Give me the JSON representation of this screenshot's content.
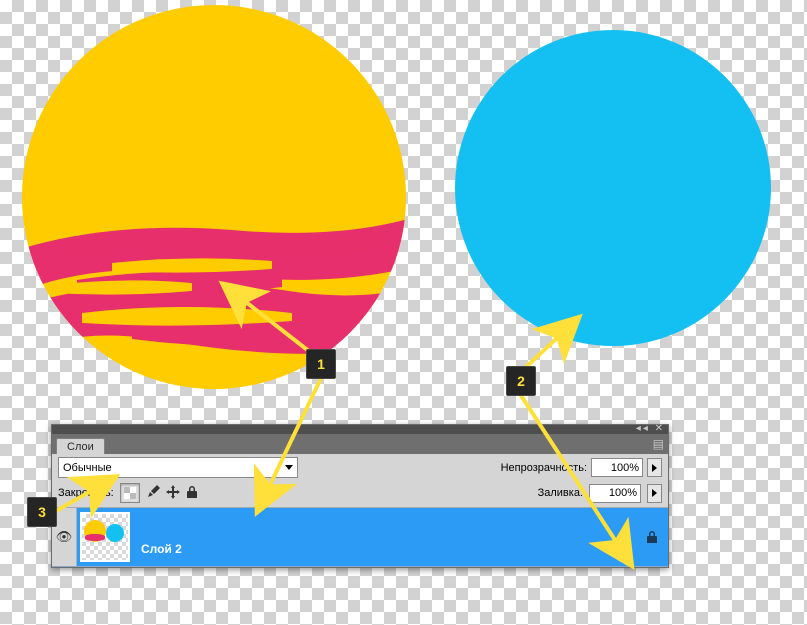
{
  "canvas": {
    "shapes": {
      "yellow_circle": "yellow circle with pink brush strokes",
      "blue_circle": "solid blue circle"
    }
  },
  "panel": {
    "tab_label": "Слои",
    "blend_mode": "Обычные",
    "opacity_label": "Непрозрачность:",
    "opacity_value": "100%",
    "lock_label": "Закрепить:",
    "fill_label": "Заливка:",
    "fill_value": "100%",
    "layer": {
      "name": "Слой 2"
    },
    "icons": {
      "lock_pixels": "lock-pixels-icon",
      "lock_brush": "brush-icon",
      "lock_move": "move-icon",
      "lock_all": "lock-icon",
      "layer_lock_indicator": "lock-icon"
    }
  },
  "callouts": {
    "one": "1",
    "two": "2",
    "three": "3"
  },
  "colors": {
    "yellow": "#ffcc00",
    "blue": "#14c0f2",
    "pink": "#e62f6c",
    "highlight": "#2b9bf6"
  }
}
